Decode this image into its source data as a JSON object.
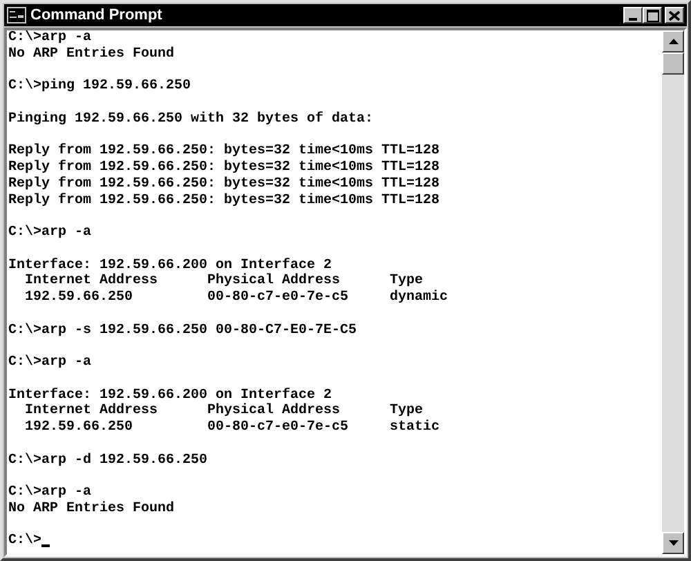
{
  "window": {
    "title": "Command Prompt"
  },
  "console": {
    "blocks": [
      [
        "C:\\>arp -a",
        "No ARP Entries Found"
      ],
      [
        "C:\\>ping 192.59.66.250"
      ],
      [
        "Pinging 192.59.66.250 with 32 bytes of data:"
      ],
      [
        "Reply from 192.59.66.250: bytes=32 time<10ms TTL=128",
        "Reply from 192.59.66.250: bytes=32 time<10ms TTL=128",
        "Reply from 192.59.66.250: bytes=32 time<10ms TTL=128",
        "Reply from 192.59.66.250: bytes=32 time<10ms TTL=128"
      ],
      [
        "C:\\>arp -a"
      ],
      [
        "Interface: 192.59.66.200 on Interface 2",
        "  Internet Address      Physical Address      Type",
        "  192.59.66.250         00-80-c7-e0-7e-c5     dynamic"
      ],
      [
        "C:\\>arp -s 192.59.66.250 00-80-C7-E0-7E-C5"
      ],
      [
        "C:\\>arp -a"
      ],
      [
        "Interface: 192.59.66.200 on Interface 2",
        "  Internet Address      Physical Address      Type",
        "  192.59.66.250         00-80-c7-e0-7e-c5     static"
      ],
      [
        "C:\\>arp -d 192.59.66.250"
      ],
      [
        "C:\\>arp -a",
        "No ARP Entries Found"
      ],
      [
        "C:\\>"
      ]
    ]
  }
}
